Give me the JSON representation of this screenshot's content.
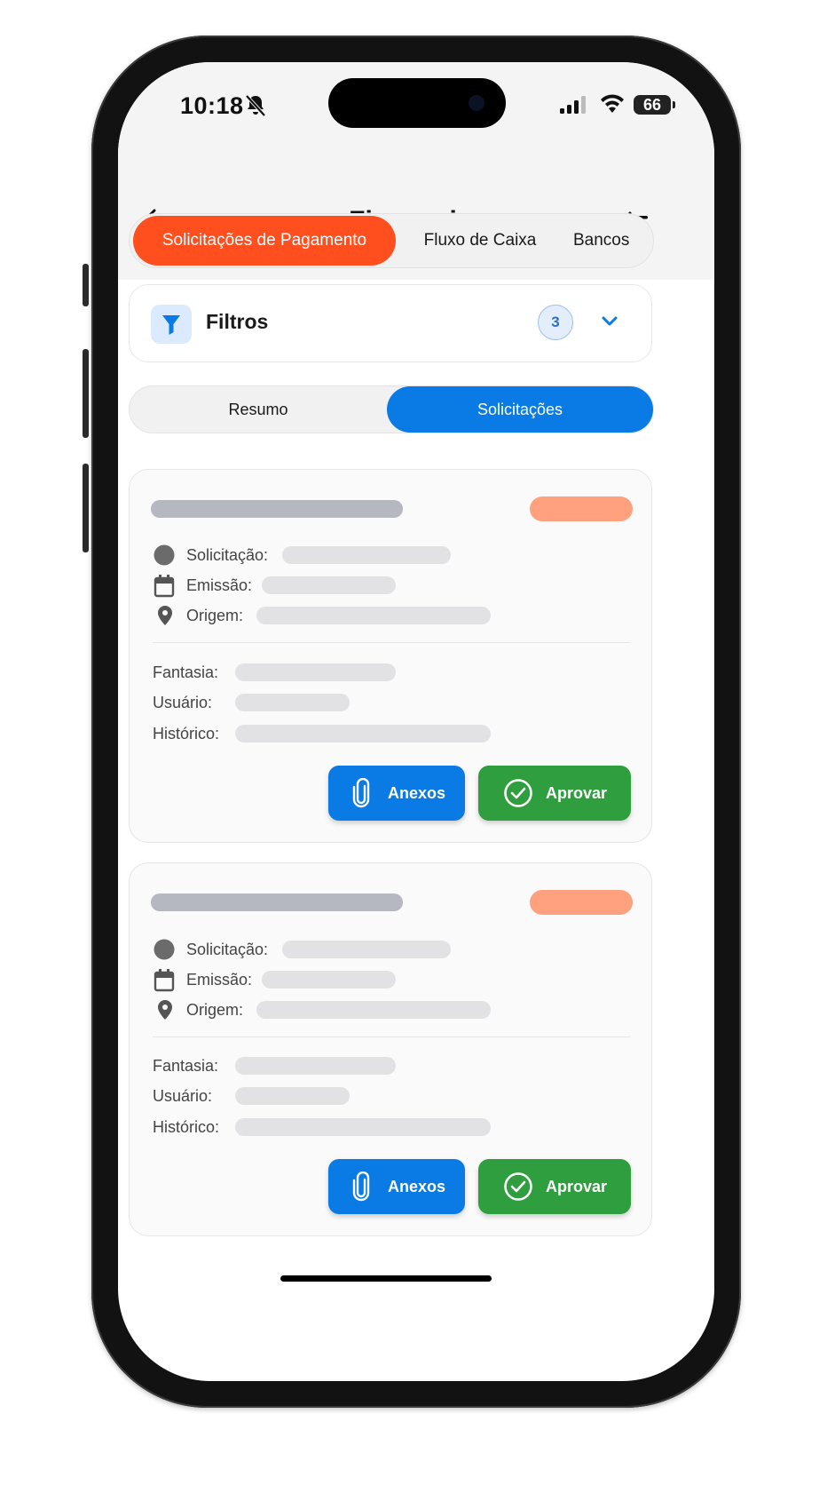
{
  "status_bar": {
    "time": "10:18",
    "battery": "66"
  },
  "header": {
    "title": "Financeiro"
  },
  "tabs": [
    {
      "label": "Solicitações de Pagamento",
      "active": true
    },
    {
      "label": "Fluxo de Caixa",
      "active": false
    },
    {
      "label": "Bancos",
      "active": false
    }
  ],
  "filters": {
    "label": "Filtros",
    "count": "3"
  },
  "segment": {
    "items": [
      "Resumo",
      "Solicitações"
    ],
    "selected": "Solicitações"
  },
  "cards": [
    {
      "labels": {
        "solicitacao": "Solicitação:",
        "emissao": "Emissão:",
        "origem": "Origem:",
        "fantasia": "Fantasia:",
        "usuario": "Usuário:",
        "historico": "Histórico:"
      },
      "buttons": {
        "attachments": "Anexos",
        "approve": "Aprovar"
      }
    },
    {
      "labels": {
        "solicitacao": "Solicitação:",
        "emissao": "Emissão:",
        "origem": "Origem:",
        "fantasia": "Fantasia:",
        "usuario": "Usuário:",
        "historico": "Histórico:"
      },
      "buttons": {
        "attachments": "Anexos",
        "approve": "Aprovar"
      }
    }
  ],
  "colors": {
    "accent_orange": "#ff4f1f",
    "accent_blue": "#0a7ae5",
    "approve_green": "#2f9e3f",
    "status_skeleton": "#ffa07f"
  },
  "icons": [
    "back-arrow-icon",
    "filter-icon",
    "checklist-icon",
    "funnel-icon",
    "chevron-down-icon",
    "circle-icon",
    "calendar-icon",
    "location-pin-icon",
    "paperclip-icon",
    "check-circle-icon",
    "bell-slash-icon",
    "signal-icon",
    "wifi-icon"
  ]
}
